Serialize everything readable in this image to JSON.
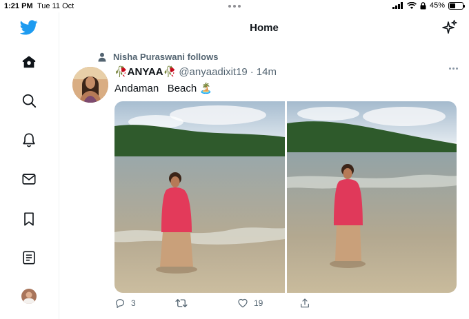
{
  "status_bar": {
    "time": "1:21 PM",
    "date": "Tue 11 Oct",
    "battery_percent": "45%",
    "battery_level": 0.45,
    "icons": [
      "signal-icon",
      "wifi-icon",
      "lock-rotation-icon",
      "battery-icon"
    ]
  },
  "sidebar": {
    "items": [
      {
        "name": "home",
        "icon": "home-icon",
        "active": true
      },
      {
        "name": "explore",
        "icon": "search-icon"
      },
      {
        "name": "notifications",
        "icon": "bell-icon"
      },
      {
        "name": "messages",
        "icon": "mail-icon"
      },
      {
        "name": "bookmarks",
        "icon": "bookmark-icon"
      },
      {
        "name": "lists",
        "icon": "list-icon"
      },
      {
        "name": "profile",
        "icon": "avatar"
      }
    ],
    "logo": "twitter-bird-icon"
  },
  "header": {
    "title": "Home",
    "right_icon": "sparkle-icon"
  },
  "tweet": {
    "social_context": "Nisha Puraswani follows",
    "display_name": "🥀ANYAA🥀",
    "handle": "@anyaadixit19",
    "separator": "·",
    "time": "14m",
    "text": "Andaman   Beach 🏝️",
    "media_count": 2,
    "actions": {
      "reply_count": "3",
      "retweet_count": "",
      "like_count": "19"
    }
  },
  "colors": {
    "twitter_blue": "#1d9bf0",
    "text_primary": "#0f1419",
    "text_secondary": "#536471",
    "divider": "#eff3f4"
  }
}
